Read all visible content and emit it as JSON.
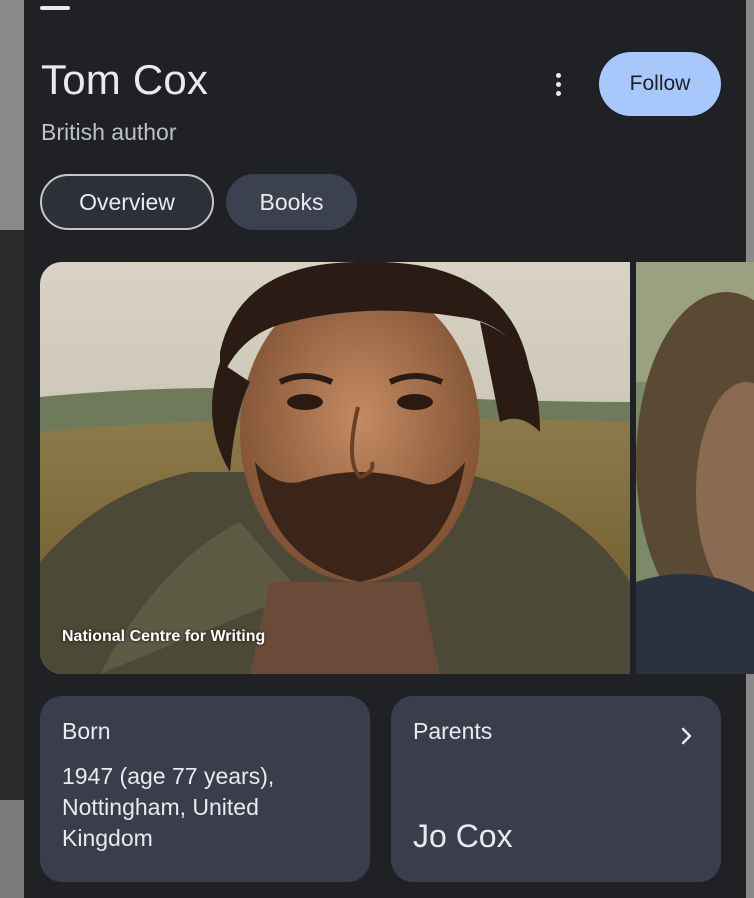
{
  "header": {
    "title": "Tom Cox",
    "subtitle": "British author",
    "follow_label": "Follow"
  },
  "tabs": [
    {
      "label": "Overview",
      "selected": true
    },
    {
      "label": "Books",
      "selected": false
    }
  ],
  "media": {
    "credit": "National Centre for Writing"
  },
  "facts": {
    "born": {
      "label": "Born",
      "value": "1947 (age 77 years), Nottingham, United Kingdom"
    },
    "parents": {
      "label": "Parents",
      "value": "Jo Cox"
    }
  },
  "colors": {
    "sheet_bg": "#202124",
    "follow_bg": "#a8c7fa",
    "card_bg": "#3a3e4c",
    "tab_selected_border": "#c4c7c5"
  },
  "icons": {
    "more": "more-vert-icon",
    "chevron": "chevron-right-icon"
  }
}
